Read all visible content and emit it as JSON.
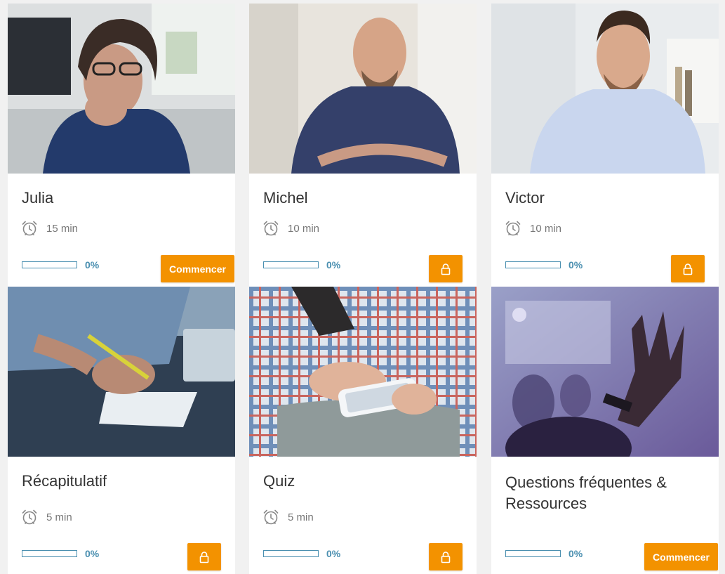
{
  "cards": [
    {
      "title": "Julia",
      "duration": "15 min",
      "progress": "0%",
      "progress_value": 0,
      "action": "Commencer",
      "locked": false,
      "photo": "woman-with-glasses-photo"
    },
    {
      "title": "Michel",
      "duration": "10 min",
      "progress": "0%",
      "progress_value": 0,
      "locked": true,
      "photo": "bald-man-arms-crossed-photo"
    },
    {
      "title": "Victor",
      "duration": "10 min",
      "progress": "0%",
      "progress_value": 0,
      "locked": true,
      "photo": "smiling-young-man-photo"
    },
    {
      "title": "Récapitulatif",
      "duration": "5 min",
      "progress": "0%",
      "progress_value": 0,
      "locked": true,
      "photo": "hand-writing-notes-photo"
    },
    {
      "title": "Quiz",
      "duration": "5 min",
      "progress": "0%",
      "progress_value": 0,
      "locked": true,
      "photo": "hands-holding-smartphone-photo"
    },
    {
      "title_line1": "Questions fréquentes &",
      "title_line2": "Ressources",
      "progress": "0%",
      "progress_value": 0,
      "action": "Commencer",
      "locked": false,
      "photo": "raised-hand-audience-photo"
    }
  ],
  "colors": {
    "accent": "#f39200",
    "progress": "#4a8fb0",
    "title": "#333333",
    "muted": "#777777",
    "background": "#f1f1f1"
  }
}
